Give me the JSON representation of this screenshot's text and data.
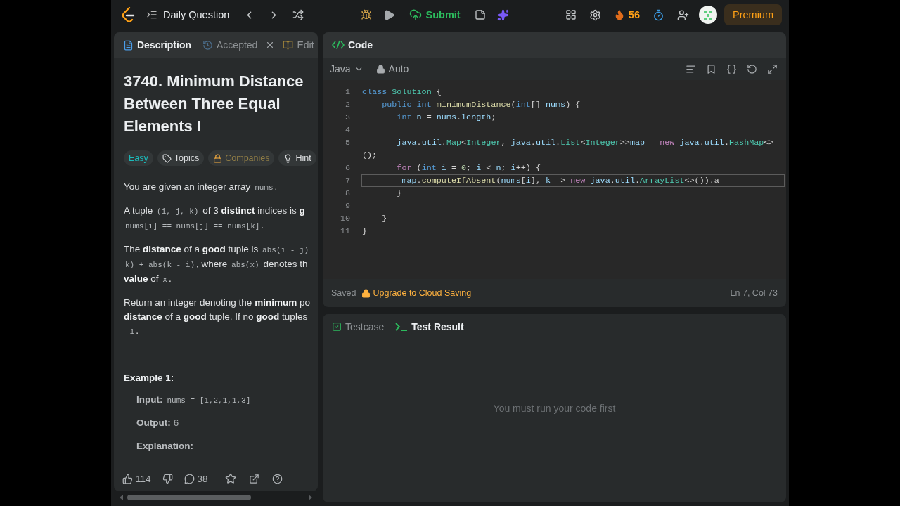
{
  "top_bar": {
    "title": "Daily Question",
    "submit": "Submit",
    "streak": "56",
    "premium": "Premium"
  },
  "description_panel": {
    "tabs": [
      {
        "label": "Description",
        "selected": true,
        "kind": "description",
        "closable": false
      },
      {
        "label": "Accepted",
        "selected": false,
        "kind": "accepted",
        "closable": true
      },
      {
        "label": "Edit",
        "selected": false,
        "kind": "editorial",
        "closable": false
      }
    ],
    "title": "3740. Minimum Distance Between Three Equal Elements I",
    "tags": [
      {
        "label": "Easy",
        "kind": "difficulty"
      },
      {
        "label": "Topics",
        "kind": "topics"
      },
      {
        "label": "Companies",
        "kind": "companies"
      },
      {
        "label": "Hint",
        "kind": "hint"
      }
    ],
    "paragraphs": [
      {
        "lines": [
          [
            {
              "kind": "text",
              "t": "You are given an integer array "
            },
            {
              "kind": "code",
              "t": "nums"
            },
            {
              "kind": "text",
              "t": "."
            }
          ]
        ]
      },
      {
        "lines": [
          [
            {
              "kind": "text",
              "t": "A tuple "
            },
            {
              "kind": "code",
              "t": "(i, j, k)"
            },
            {
              "kind": "text",
              "t": " of 3 "
            },
            {
              "kind": "bold",
              "t": "distinct"
            },
            {
              "kind": "text",
              "t": " indices is "
            },
            {
              "kind": "bold",
              "t": "g"
            }
          ],
          [
            {
              "kind": "code",
              "t": "nums[i] == nums[j] == nums[k]"
            },
            {
              "kind": "text",
              "t": "."
            }
          ]
        ]
      },
      {
        "lines": [
          [
            {
              "kind": "text",
              "t": "The "
            },
            {
              "kind": "bold",
              "t": "distance"
            },
            {
              "kind": "text",
              "t": " of a "
            },
            {
              "kind": "bold",
              "t": "good"
            },
            {
              "kind": "text",
              "t": " tuple is "
            },
            {
              "kind": "code",
              "t": "abs(i - j)"
            }
          ],
          [
            {
              "kind": "code",
              "t": "k) + abs(k - i)"
            },
            {
              "kind": "text",
              "t": ", where "
            },
            {
              "kind": "code",
              "t": "abs(x)"
            },
            {
              "kind": "text",
              "t": " denotes th"
            }
          ],
          [
            {
              "kind": "bold",
              "t": "value"
            },
            {
              "kind": "text",
              "t": " of "
            },
            {
              "kind": "code",
              "t": "x"
            },
            {
              "kind": "text",
              "t": "."
            }
          ]
        ]
      },
      {
        "lines": [
          [
            {
              "kind": "text",
              "t": "Return an integer denoting the "
            },
            {
              "kind": "bold",
              "t": "minimum"
            },
            {
              "kind": "text",
              "t": " po"
            }
          ],
          [
            {
              "kind": "bold",
              "t": "distance"
            },
            {
              "kind": "text",
              "t": " of a "
            },
            {
              "kind": "bold",
              "t": "good"
            },
            {
              "kind": "text",
              "t": " tuple. If no "
            },
            {
              "kind": "bold",
              "t": "good"
            },
            {
              "kind": "text",
              "t": " tuples"
            }
          ],
          [
            {
              "kind": "code",
              "t": "-1"
            },
            {
              "kind": "text",
              "t": "."
            }
          ]
        ]
      }
    ],
    "example": {
      "heading": "Example 1:",
      "items": [
        {
          "label": "Input:",
          "value": "nums = [1,2,1,1,3]",
          "kind": "code"
        },
        {
          "label": "Output:",
          "value": "6",
          "kind": "text"
        }
      ],
      "explanation": "Explanation:"
    },
    "footer": {
      "likes": "114",
      "comments": "38"
    }
  },
  "editor": {
    "tab": "Code",
    "language": "Java",
    "mode": "Auto",
    "lines": [
      {
        "number": "1",
        "current": false,
        "tokens": [
          {
            "kind": "keyword",
            "t": "class"
          },
          {
            "kind": "type",
            "t": " Solution"
          },
          {
            "kind": "punct",
            "t": " {"
          }
        ]
      },
      {
        "number": "2",
        "current": false,
        "tokens": [
          {
            "kind": "keyword",
            "t": "    public"
          },
          {
            "kind": "keyword",
            "t": " int"
          },
          {
            "kind": "function",
            "t": " minimumDistance"
          },
          {
            "kind": "punct",
            "t": "("
          },
          {
            "kind": "keyword",
            "t": "int"
          },
          {
            "kind": "punct",
            "t": "[] "
          },
          {
            "kind": "variable",
            "t": "nums"
          },
          {
            "kind": "punct",
            "t": ") {"
          }
        ]
      },
      {
        "number": "3",
        "current": false,
        "tokens": [
          {
            "kind": "keyword",
            "t": "       int"
          },
          {
            "kind": "variable",
            "t": " n"
          },
          {
            "kind": "punct",
            "t": " = "
          },
          {
            "kind": "variable",
            "t": "nums"
          },
          {
            "kind": "punct",
            "t": "."
          },
          {
            "kind": "variable",
            "t": "length"
          },
          {
            "kind": "punct",
            "t": ";"
          }
        ]
      },
      {
        "number": "4",
        "current": false
      },
      {
        "number": "5",
        "current": false,
        "tokens": [
          {
            "kind": "variable",
            "t": "       java"
          },
          {
            "kind": "punct",
            "t": "."
          },
          {
            "kind": "variable",
            "t": "util"
          },
          {
            "kind": "punct",
            "t": "."
          },
          {
            "kind": "type",
            "t": "Map"
          },
          {
            "kind": "punct",
            "t": "<"
          },
          {
            "kind": "type",
            "t": "Integer"
          },
          {
            "kind": "punct",
            "t": ", "
          },
          {
            "kind": "variable",
            "t": "java"
          },
          {
            "kind": "punct",
            "t": "."
          },
          {
            "kind": "variable",
            "t": "util"
          },
          {
            "kind": "punct",
            "t": "."
          },
          {
            "kind": "type",
            "t": "List"
          },
          {
            "kind": "punct",
            "t": "<"
          },
          {
            "kind": "type",
            "t": "Integer"
          },
          {
            "kind": "punct",
            "t": ">>"
          },
          {
            "kind": "variable",
            "t": "map"
          },
          {
            "kind": "punct",
            "t": " = "
          },
          {
            "kind": "control",
            "t": "new"
          },
          {
            "kind": "variable",
            "t": " java"
          },
          {
            "kind": "punct",
            "t": "."
          },
          {
            "kind": "variable",
            "t": "util"
          },
          {
            "kind": "punct",
            "t": "."
          },
          {
            "kind": "type",
            "t": "HashMap"
          },
          {
            "kind": "punct",
            "t": "<>"
          }
        ],
        "wrap": [
          {
            "kind": "punct",
            "t": "();"
          }
        ]
      },
      {
        "number": "6",
        "current": false,
        "tokens": [
          {
            "kind": "control",
            "t": "       for"
          },
          {
            "kind": "punct",
            "t": " ("
          },
          {
            "kind": "keyword",
            "t": "int"
          },
          {
            "kind": "variable",
            "t": " i"
          },
          {
            "kind": "punct",
            "t": " = "
          },
          {
            "kind": "number",
            "t": "0"
          },
          {
            "kind": "punct",
            "t": "; "
          },
          {
            "kind": "variable",
            "t": "i"
          },
          {
            "kind": "punct",
            "t": " < "
          },
          {
            "kind": "variable",
            "t": "n"
          },
          {
            "kind": "punct",
            "t": "; "
          },
          {
            "kind": "variable",
            "t": "i"
          },
          {
            "kind": "punct",
            "t": "++) {"
          }
        ]
      },
      {
        "number": "7",
        "current": true,
        "tokens": [
          {
            "kind": "variable",
            "t": "        map"
          },
          {
            "kind": "punct",
            "t": "."
          },
          {
            "kind": "function",
            "t": "computeIfAbsent"
          },
          {
            "kind": "punct",
            "t": "("
          },
          {
            "kind": "variable",
            "t": "nums"
          },
          {
            "kind": "punct",
            "t": "["
          },
          {
            "kind": "variable",
            "t": "i"
          },
          {
            "kind": "punct",
            "t": "], "
          },
          {
            "kind": "variable",
            "t": "k"
          },
          {
            "kind": "punct",
            "t": " -> "
          },
          {
            "kind": "control",
            "t": "new"
          },
          {
            "kind": "variable",
            "t": " java"
          },
          {
            "kind": "punct",
            "t": "."
          },
          {
            "kind": "variable",
            "t": "util"
          },
          {
            "kind": "punct",
            "t": "."
          },
          {
            "kind": "type",
            "t": "ArrayList"
          },
          {
            "kind": "punct",
            "t": "<>()).a"
          }
        ]
      },
      {
        "number": "8",
        "current": false,
        "tokens": [
          {
            "kind": "punct",
            "t": "       }"
          }
        ]
      },
      {
        "number": "9",
        "current": false
      },
      {
        "number": "10",
        "current": false,
        "tokens": [
          {
            "kind": "punct",
            "t": "    }"
          }
        ]
      },
      {
        "number": "11",
        "current": false,
        "tokens": [
          {
            "kind": "punct",
            "t": "}"
          }
        ]
      }
    ],
    "status": {
      "saved": "Saved",
      "upgrade": "Upgrade to Cloud Saving",
      "position": "Ln 7, Col 73"
    }
  },
  "result_panel": {
    "tabs": [
      {
        "label": "Testcase",
        "selected": false,
        "kind": "testcase"
      },
      {
        "label": "Test Result",
        "selected": true,
        "kind": "result"
      }
    ],
    "message": "You must run your code first"
  }
}
